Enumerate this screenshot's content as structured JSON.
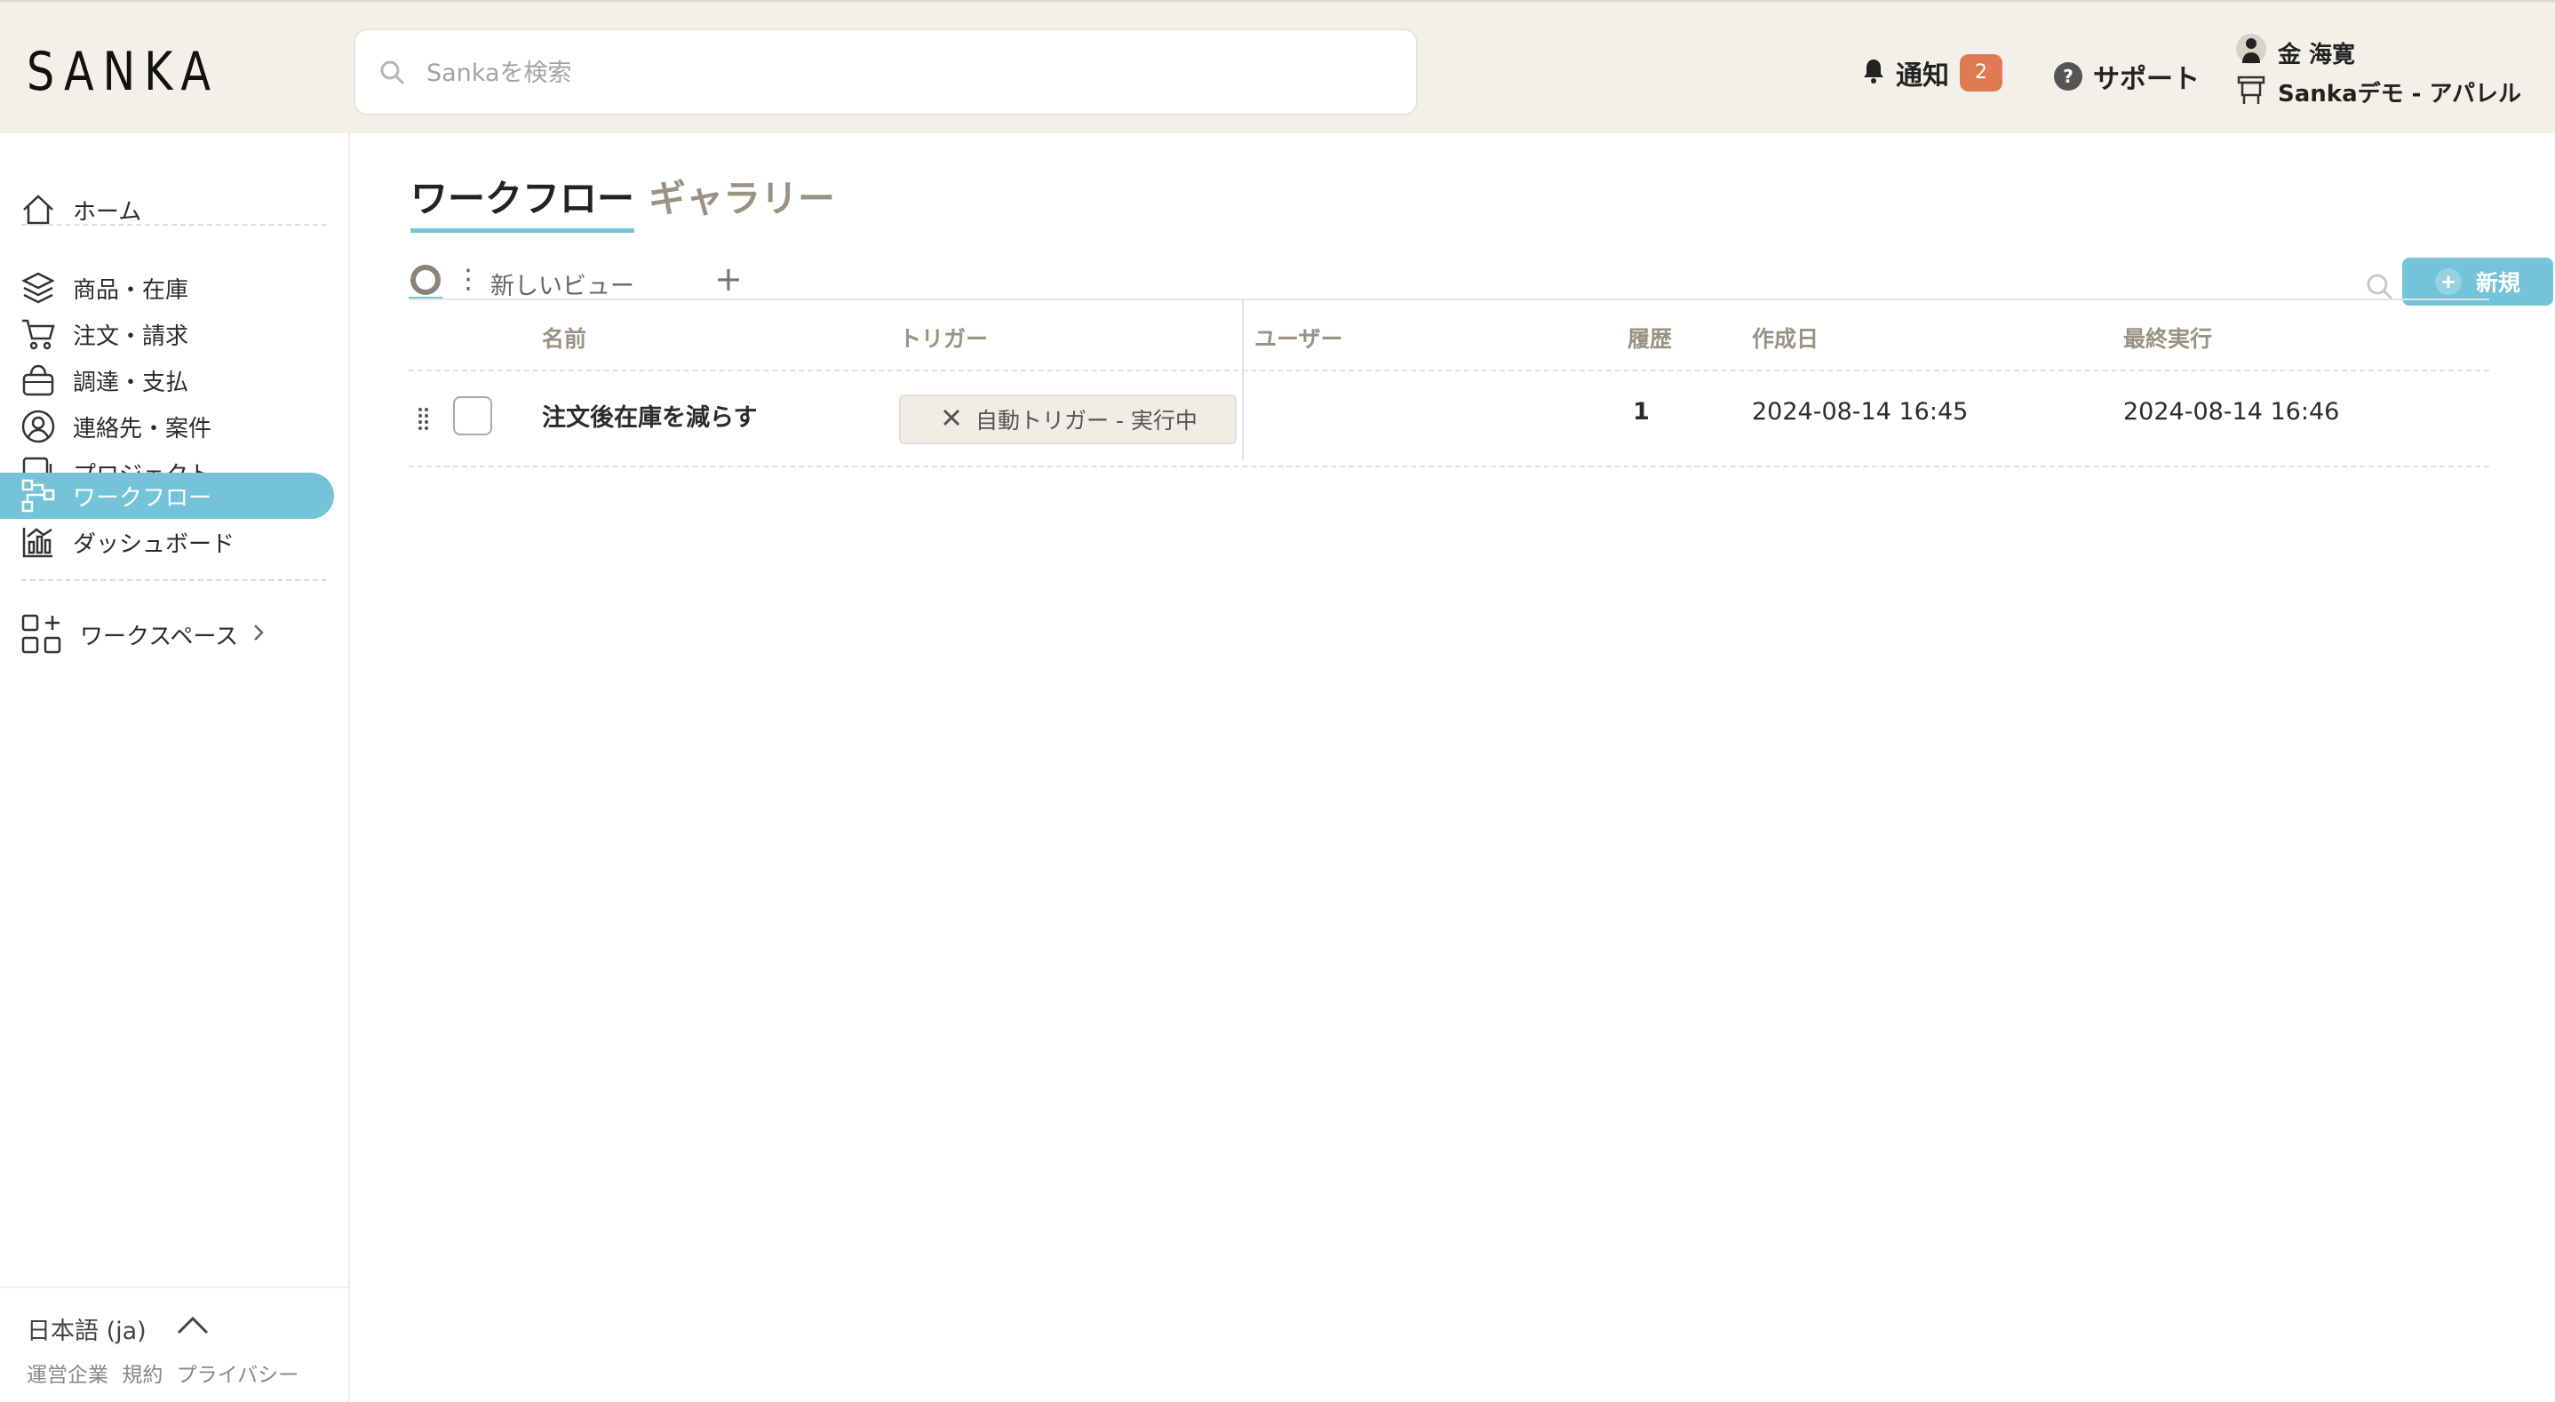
{
  "brand": {
    "logo": "SANKA"
  },
  "header": {
    "search_placeholder": "Sankaを検索",
    "notifications_label": "通知",
    "notifications_count": "2",
    "support_label": "サポート",
    "user_name": "金 海寛",
    "workspace_name": "Sankaデモ - アパレル",
    "badge_color": "#e07a52"
  },
  "sidebar": {
    "items": [
      {
        "label": "ホーム",
        "icon": "home-icon"
      },
      {
        "label": "商品・在庫",
        "icon": "layers-icon"
      },
      {
        "label": "注文・請求",
        "icon": "cart-icon"
      },
      {
        "label": "調達・支払",
        "icon": "basket-icon"
      },
      {
        "label": "連絡先・案件",
        "icon": "user-circle-icon"
      },
      {
        "label": "プロジェクト",
        "icon": "project-icon"
      },
      {
        "label": "ワークフロー",
        "icon": "workflow-icon",
        "active": true
      },
      {
        "label": "ダッシュボード",
        "icon": "dashboard-icon"
      }
    ],
    "workspace_label": "ワークスペース",
    "language": "日本語 (ja)",
    "footer_links": [
      "運営企業",
      "規約",
      "プライバシー"
    ],
    "active_color": "#74c3d8"
  },
  "main": {
    "tabs": [
      {
        "label": "ワークフロー",
        "active": true
      },
      {
        "label": "ギャラリー",
        "active": false
      }
    ],
    "view_label": "新しいビュー",
    "add_view": "+",
    "new_button": "新規",
    "columns": [
      "名前",
      "トリガー",
      "ユーザー",
      "履歴",
      "作成日",
      "最終実行"
    ],
    "rows": [
      {
        "name": "注文後在庫を減らす",
        "trigger": "自動トリガー - 実行中",
        "user": "",
        "history": "1",
        "created": "2024-08-14 16:45",
        "last_run": "2024-08-14 16:46"
      }
    ]
  }
}
